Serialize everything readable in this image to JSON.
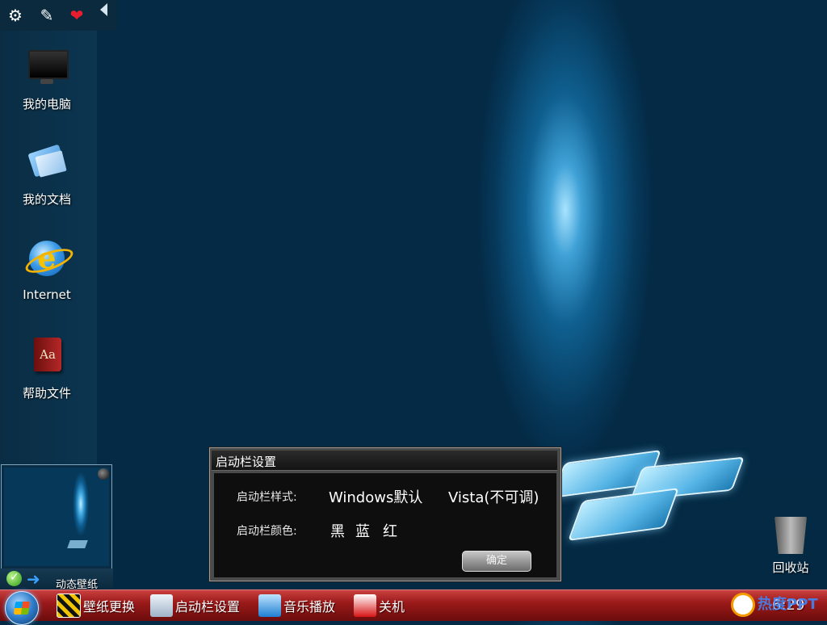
{
  "top_tools": {
    "icons": [
      "settings-icon",
      "pin-icon",
      "heart-icon"
    ]
  },
  "desktop_icons": [
    {
      "label": "我的电脑",
      "icon": "monitor-icon"
    },
    {
      "label": "我的文档",
      "icon": "documents-icon"
    },
    {
      "label": "Internet",
      "icon": "ie-icon"
    },
    {
      "label": "帮助文件",
      "icon": "book-icon"
    }
  ],
  "wallpaper_widget": {
    "label": "动态壁纸"
  },
  "recycle_bin": {
    "label": "回收站"
  },
  "dialog": {
    "title": "启动栏设置",
    "style_label": "启动栏样式:",
    "style_options": [
      "Windows默认",
      "Vista(不可调)"
    ],
    "color_label": "启动栏颜色:",
    "color_options": [
      "黑",
      "蓝",
      "红"
    ],
    "confirm": "确定"
  },
  "taskbar": {
    "items": [
      "壁纸更换",
      "启动栏设置",
      "音乐播放",
      "关机"
    ],
    "clock": "6:29",
    "brand": "热度PPT"
  },
  "colors": {
    "taskbar": "#9c1a1a",
    "desktop": "#0f5f8f",
    "dialog_bg": "#0e0e0e"
  }
}
